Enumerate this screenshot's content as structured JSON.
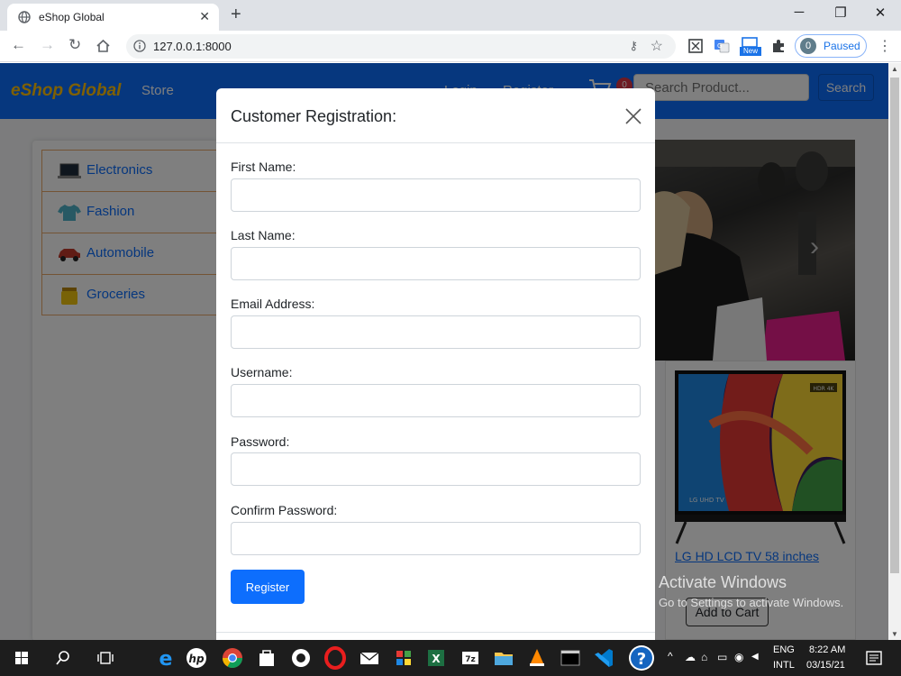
{
  "browser": {
    "tab_title": "eShop Global",
    "tab_close": "✕",
    "new_tab": "+",
    "url": "127.0.0.1:8000",
    "profile_initial": "0",
    "profile_status": "Paused",
    "window_minimize": "─",
    "window_restore": "❐",
    "window_close": "✕",
    "ext_new_badge": "New"
  },
  "site": {
    "brand": "eShop Global",
    "nav_store": "Store",
    "nav_login": "Login",
    "nav_register": "Register",
    "cart_count": "0",
    "search_placeholder": "Search Product...",
    "search_button": "Search"
  },
  "sidebar": {
    "categories": [
      {
        "label": "Electronics",
        "icon": "laptop-icon"
      },
      {
        "label": "Fashion",
        "icon": "tshirt-icon"
      },
      {
        "label": "Automobile",
        "icon": "car-icon"
      },
      {
        "label": "Groceries",
        "icon": "grocery-jar-icon"
      }
    ]
  },
  "product": {
    "name": "LG HD LCD TV 58 inches",
    "add_to_cart": "Add to Cart",
    "badge_text": "HDR 4K",
    "brand_text": "LG UHD TV"
  },
  "modal": {
    "title": "Customer Registration:",
    "fields": [
      {
        "label": "First Name:",
        "value": ""
      },
      {
        "label": "Last Name:",
        "value": ""
      },
      {
        "label": "Email Address:",
        "value": ""
      },
      {
        "label": "Username:",
        "value": ""
      },
      {
        "label": "Password:",
        "value": ""
      },
      {
        "label": "Confirm Password:",
        "value": ""
      }
    ],
    "submit_label": "Register"
  },
  "watermark": {
    "title": "Activate Windows",
    "subtitle": "Go to Settings to activate Windows."
  },
  "taskbar": {
    "lang_top": "ENG",
    "lang_bottom": "INTL",
    "time": "8:22 AM",
    "date": "03/15/21"
  },
  "colors": {
    "primary": "#0d6efd",
    "brand_yellow": "#ffc107",
    "badge_red": "#dc3545",
    "category_border": "#e8a86a"
  }
}
